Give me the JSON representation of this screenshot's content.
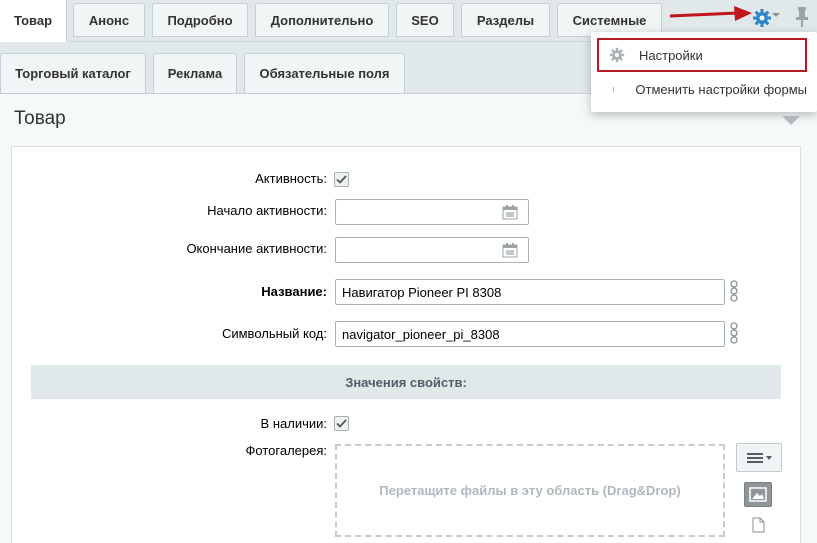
{
  "tabs_row1": [
    {
      "label": "Товар",
      "active": true
    },
    {
      "label": "Анонс"
    },
    {
      "label": "Подробно"
    },
    {
      "label": "Дополнительно"
    },
    {
      "label": "SEO"
    },
    {
      "label": "Разделы"
    },
    {
      "label": "Системные"
    }
  ],
  "tabs_row2": [
    {
      "label": "Торговый каталог"
    },
    {
      "label": "Реклама"
    },
    {
      "label": "Обязательные поля"
    }
  ],
  "settings_menu": {
    "settings_label": "Настройки",
    "reset_label": "Отменить настройки формы"
  },
  "section_title": "Товар",
  "form": {
    "active_label": "Активность:",
    "active_checked": true,
    "start_label": "Начало активности:",
    "start_value": "",
    "end_label": "Окончание активности:",
    "end_value": "",
    "name_label": "Название:",
    "name_value": "Навигатор Pioneer PI 8308",
    "code_label": "Символьный код:",
    "code_value": "navigator_pioneer_pi_8308",
    "properties_header": "Значения свойств:",
    "in_stock_label": "В наличии:",
    "in_stock_checked": true,
    "gallery_label": "Фотогалерея:",
    "dropzone_text": "Перетащите файлы в эту область (Drag&Drop)"
  },
  "colors": {
    "accent": "#2f86c9",
    "highlight_border": "#b31b21",
    "arrow": "#c0171f"
  }
}
